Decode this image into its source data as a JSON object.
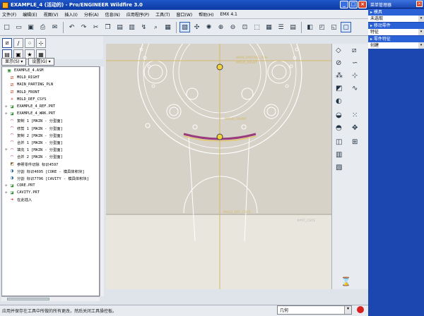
{
  "window": {
    "title": "EXAMPLE_4 (活动的) - Pro/ENGINEER Wildfire 3.0",
    "minimize": "_",
    "maximize": "□",
    "close": "×"
  },
  "menu": [
    "文件(F)",
    "编辑(E)",
    "视图(V)",
    "插入(I)",
    "分析(A)",
    "信息(N)",
    "应用程序(P)",
    "工具(T)",
    "窗口(W)",
    "帮助(H)",
    "EMX 4.1"
  ],
  "toolbar_icons": [
    "new-icon",
    "open-icon",
    "save-icon",
    "print-icon",
    "email-icon",
    "undo-icon",
    "redo-icon",
    "cut-icon",
    "copy-icon",
    "paste-icon",
    "paste-special-icon",
    "regenerate-icon",
    "find-icon",
    "select-icon",
    "repaint-icon",
    "spin-center-icon",
    "orient-icon",
    "zoom-in-icon",
    "zoom-out-icon",
    "refit-icon",
    "reorient-icon",
    "saved-views-icon",
    "layers-icon",
    "view-manager-icon",
    "shading-icon",
    "hidden-line-icon",
    "no-hidden-icon",
    "wireframe-icon"
  ],
  "tree": {
    "show_btn": "显示(S) ▾",
    "settings_btn": "设置(G) ▾",
    "items": [
      {
        "label": "EXAMPLE_4.ASM",
        "icon": "assembly-icon",
        "color": "#2a8a2a",
        "indent": 0,
        "exp": ""
      },
      {
        "label": "MOLD_RIGHT",
        "icon": "datum-plane-icon",
        "color": "#c04020",
        "indent": 1,
        "exp": ""
      },
      {
        "label": "MAIN_PARTING_PLN",
        "icon": "datum-plane-icon",
        "color": "#c04020",
        "indent": 1,
        "exp": ""
      },
      {
        "label": "MOLD_FRONT",
        "icon": "datum-plane-icon",
        "color": "#c04020",
        "indent": 1,
        "exp": ""
      },
      {
        "label": "MOLD_DEF_CSYS",
        "icon": "csys-icon",
        "color": "#c04020",
        "indent": 1,
        "exp": ""
      },
      {
        "label": "EXAMPLE_4_REF.PRT",
        "icon": "part-icon",
        "color": "#2a8a2a",
        "indent": 1,
        "exp": "+"
      },
      {
        "label": "EXAMPLE_4_WRK.PRT",
        "icon": "part-icon",
        "color": "#2a8a2a",
        "indent": 1,
        "exp": "+"
      },
      {
        "label": "复制 1 [MAIN - 分型面]",
        "icon": "surface-icon",
        "color": "#c02090",
        "indent": 1,
        "exp": ""
      },
      {
        "label": "修剪 1 [MAIN - 分型面]",
        "icon": "surface-icon",
        "color": "#c02090",
        "indent": 1,
        "exp": ""
      },
      {
        "label": "复制 2 [MAIN - 分型面]",
        "icon": "surface-icon",
        "color": "#c02090",
        "indent": 1,
        "exp": ""
      },
      {
        "label": "合并 1 [MAIN - 分型面]",
        "icon": "surface-icon",
        "color": "#c02090",
        "indent": 1,
        "exp": ""
      },
      {
        "label": "填充 1 [MAIN - 分型面]",
        "icon": "surface-icon",
        "color": "#c02090",
        "indent": 1,
        "exp": "+"
      },
      {
        "label": "合并 2 [MAIN - 分型面]",
        "icon": "surface-icon",
        "color": "#c02090",
        "indent": 1,
        "exp": ""
      },
      {
        "label": "参照零件切除 标识4597",
        "icon": "cut-feature-icon",
        "color": "#806030",
        "indent": 1,
        "exp": ""
      },
      {
        "label": "分割 标识4695 [CORE - 模具体积块]",
        "icon": "split-icon",
        "color": "#206090",
        "indent": 1,
        "exp": ""
      },
      {
        "label": "分割 标识7796 [CAVITY - 模具体积块]",
        "icon": "split-icon",
        "color": "#206090",
        "indent": 1,
        "exp": ""
      },
      {
        "label": "CORE.PRT",
        "icon": "part-icon",
        "color": "#2a8a2a",
        "indent": 1,
        "exp": "+"
      },
      {
        "label": "CAVITY.PRT",
        "icon": "part-icon",
        "color": "#2a8a2a",
        "indent": 1,
        "exp": "+"
      },
      {
        "label": "在此插入",
        "icon": "insert-here-icon",
        "color": "#d02020",
        "indent": 1,
        "exp": ""
      }
    ]
  },
  "graphics": {
    "label1": "MAIN_PARTING_PLN",
    "label2": "MOLD_RIGHT",
    "label3": "MOLD_FRONT",
    "label4": "MOLD_DEF_CSYS",
    "label5": "#PRT_CSYS"
  },
  "statusbar": {
    "message": "应用并保存在工具中所做的所有更改，然后关闭工具操控板。",
    "filter": "几何"
  },
  "menu_manager": {
    "title": "菜单管理器",
    "close": "×",
    "sections": [
      {
        "header": "模具",
        "items": [
          {
            "label": "未选取",
            "dd": true
          }
        ]
      },
      {
        "header": "移动零件",
        "items": [
          {
            "label": "特征",
            "dd": true
          }
        ]
      },
      {
        "header": "零件特征",
        "items": [
          {
            "label": "创建",
            "dd": true
          }
        ]
      }
    ]
  }
}
